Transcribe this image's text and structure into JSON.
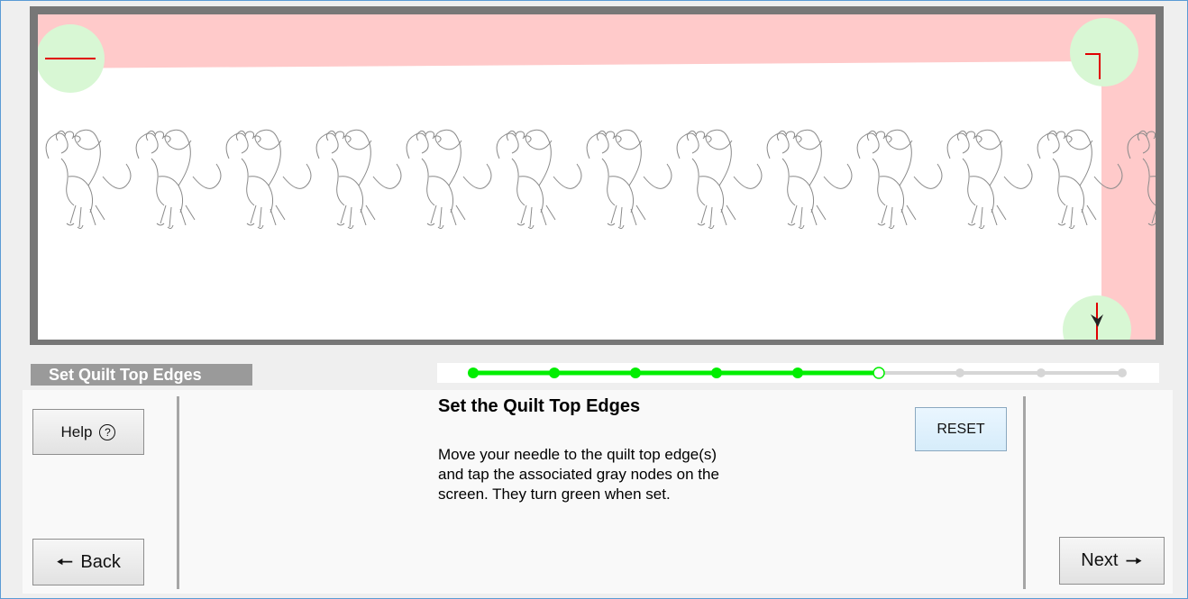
{
  "step": {
    "label": "Set Quilt Top Edges"
  },
  "progress": {
    "total_steps": 9,
    "completed_steps": 5,
    "current_step": 6,
    "color_done": "#00ee00",
    "color_pending": "#d6d6d6"
  },
  "instructions": {
    "heading": "Set the Quilt Top Edges",
    "lines": [
      "Move your needle to the quilt top edge(s)",
      "and tap the associated gray nodes on the",
      "screen. They turn green when set."
    ]
  },
  "buttons": {
    "help_label": "Help",
    "back_label": "Back",
    "next_label": "Next",
    "reset_label": "RESET"
  },
  "canvas": {
    "edge_band_color": "#ffcaca",
    "node_color": "#d8f7d4",
    "marker_color": "#e00000",
    "pattern_stroke": "#8a8a8a"
  }
}
